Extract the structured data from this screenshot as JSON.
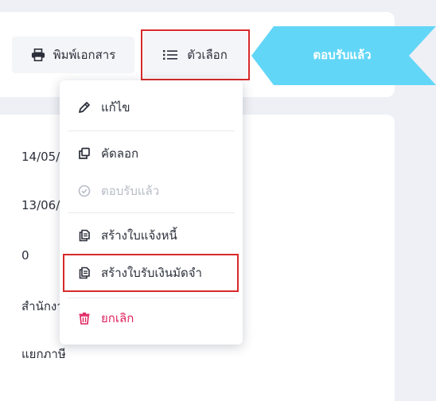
{
  "toolbar": {
    "print_label": "พิมพ์เอกสาร",
    "options_label": "ตัวเลือก",
    "status_label": "ตอบรับแล้ว"
  },
  "details": {
    "values": [
      "14/05/",
      "13/06/",
      "0",
      "สำนักงา",
      "แยกภาษี"
    ]
  },
  "menu": {
    "items": [
      {
        "label": "แก้ไข",
        "icon": "pencil-icon",
        "state": "normal"
      },
      {
        "label": "คัดลอก",
        "icon": "copy-icon",
        "state": "normal"
      },
      {
        "label": "ตอบรับแล้ว",
        "icon": "check-circle-icon",
        "state": "disabled"
      },
      {
        "label": "สร้างใบแจ้งหนี้",
        "icon": "document-icon",
        "state": "normal"
      },
      {
        "label": "สร้างใบรับเงินมัดจำ",
        "icon": "document-icon",
        "state": "normal"
      },
      {
        "label": "ยกเลิก",
        "icon": "trash-icon",
        "state": "danger"
      }
    ]
  },
  "colors": {
    "status_bg": "#62d6f7",
    "highlight": "#d72a2a",
    "danger": "#e0245e",
    "disabled": "#b8bcc6"
  }
}
